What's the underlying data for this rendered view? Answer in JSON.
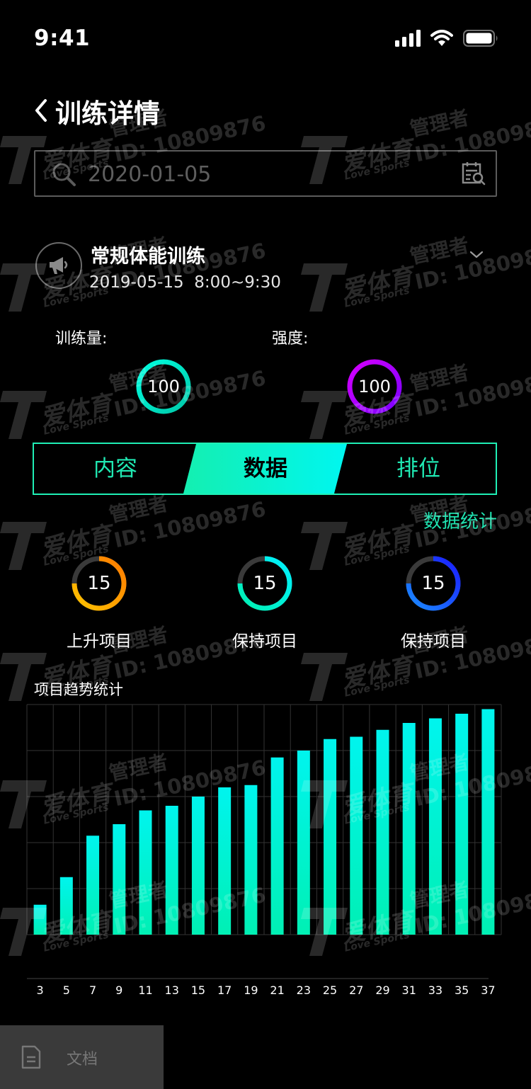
{
  "status_bar": {
    "time": "9:41"
  },
  "nav": {
    "title": "训练详情"
  },
  "search": {
    "placeholder": "2020-01-05"
  },
  "session": {
    "title": "常规体能训练",
    "date": "2019-05-15",
    "time_range": "8:00~9:30"
  },
  "metrics": [
    {
      "label": "训练量:",
      "value": "100",
      "color": "#11e9c7"
    },
    {
      "label": "强度:",
      "value": "100",
      "color": "#b600ff"
    }
  ],
  "tabs": [
    {
      "label": "内容",
      "active": false
    },
    {
      "label": "数据",
      "active": true
    },
    {
      "label": "排位",
      "active": false
    }
  ],
  "stats_link": "数据统计",
  "stats": [
    {
      "value": "15",
      "label": "上升项目",
      "color": "#ff9a00"
    },
    {
      "value": "15",
      "label": "保持项目",
      "color": "#00e8c6"
    },
    {
      "value": "15",
      "label": "保持项目",
      "color": "#1c4cff"
    }
  ],
  "chart_title": "项目趋势统计",
  "chart_data": {
    "type": "bar",
    "categories": [
      "3",
      "5",
      "7",
      "9",
      "11",
      "13",
      "15",
      "17",
      "19",
      "21",
      "23",
      "25",
      "27",
      "29",
      "31",
      "33",
      "35",
      "37"
    ],
    "values": [
      13,
      25,
      43,
      48,
      54,
      56,
      60,
      64,
      65,
      77,
      80,
      85,
      86,
      89,
      92,
      94,
      96,
      98
    ],
    "ylim": [
      0,
      100
    ],
    "grid": true,
    "colors": [
      "#00f2b8",
      "#00f2ee"
    ]
  },
  "watermark": {
    "brand": "爱体育",
    "brand_en": "Love Sports",
    "role": "管理者",
    "id": "ID: 10809876"
  },
  "bottom_tab": {
    "label": "文档"
  }
}
